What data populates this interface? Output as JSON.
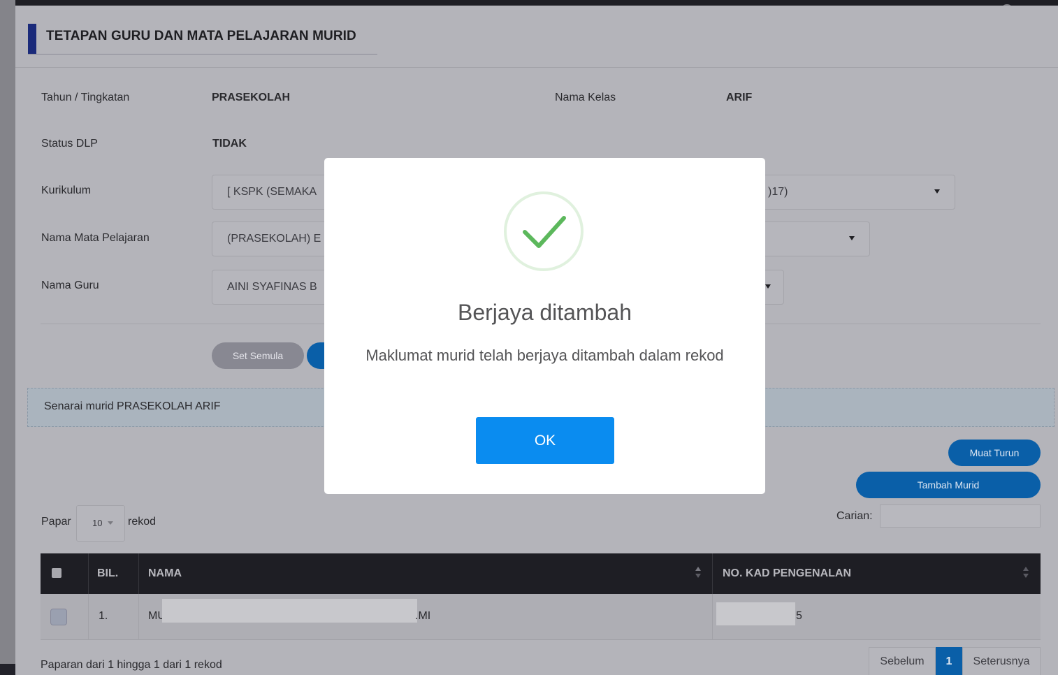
{
  "page": {
    "title": "TETAPAN GURU DAN MATA PELAJARAN MURID"
  },
  "info": {
    "tahun_label": "Tahun / Tingkatan",
    "tahun_value": "PRASEKOLAH",
    "kelas_label": "Nama Kelas",
    "kelas_value": "ARIF",
    "dlp_label": "Status DLP",
    "dlp_value": "TIDAK"
  },
  "form": {
    "kurikulum_label": "Kurikulum",
    "kurikulum_value": "[ KSPK (SEMAKA",
    "kurikulum_value_tail": ")17)",
    "subjek_label": "Nama Mata Pelajaran",
    "subjek_value": "(PRASEKOLAH) E",
    "guru_label": "Nama Guru",
    "guru_value": "AINI SYAFINAS B"
  },
  "actions": {
    "reset_label": "Set Semula"
  },
  "list": {
    "banner": "Senarai murid PRASEKOLAH ARIF",
    "download_label": "Muat Turun",
    "add_label": "Tambah Murid",
    "show_prefix": "Papar",
    "page_size": "10",
    "show_suffix": "rekod",
    "search_label": "Carian:",
    "search_value": ""
  },
  "table": {
    "headers": {
      "bil": "BIL.",
      "nama": "NAMA",
      "ic": "NO. KAD PENGENALAN"
    },
    "rows": [
      {
        "bil": "1.",
        "nama_start": "MU",
        "nama_end": ".MI",
        "ic_end": "5"
      }
    ]
  },
  "footer": {
    "summary": "Paparan dari 1 hingga 1 dari 1 rekod",
    "prev_label": "Sebelum",
    "current_page": "1",
    "next_label": "Seterusnya"
  },
  "modal": {
    "icon": "check-icon",
    "title": "Berjaya ditambah",
    "message": "Maklumat murid telah berjaya ditambah dalam rekod",
    "ok_label": "OK"
  },
  "colors": {
    "ok_button": "#0a8cf0",
    "check": "#5cb85c",
    "accent": "#1a2a7a"
  }
}
